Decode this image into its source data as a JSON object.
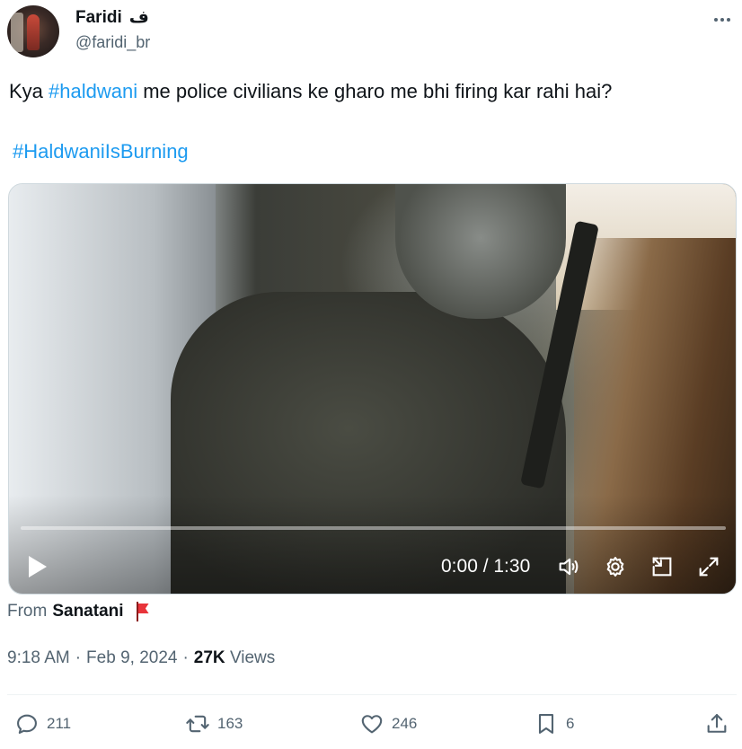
{
  "author": {
    "display_name": "Faridi",
    "name_suffix": "ف",
    "handle": "@faridi_br"
  },
  "tweet": {
    "text_prefix": "Kya ",
    "hashtag1": "#haldwani",
    "text_suffix": " me police civilians ke gharo me bhi firing kar rahi hai?",
    "hashtag2": "#HaldwaniIsBurning"
  },
  "video": {
    "time_display": "0:00 / 1:30",
    "progress_fraction": 0
  },
  "source": {
    "prefix": "From",
    "name": "Sanatani"
  },
  "meta": {
    "time": "9:18 AM",
    "sep1": "·",
    "date": "Feb 9, 2024",
    "sep2": "·",
    "views_count": "27K",
    "views_label": "Views"
  },
  "actions": {
    "replies": "211",
    "reposts": "163",
    "likes": "246",
    "bookmarks": "6"
  },
  "colors": {
    "link": "#1d9bf0",
    "text": "#0f1419",
    "secondary": "#536471",
    "flag": "#e8343a"
  }
}
